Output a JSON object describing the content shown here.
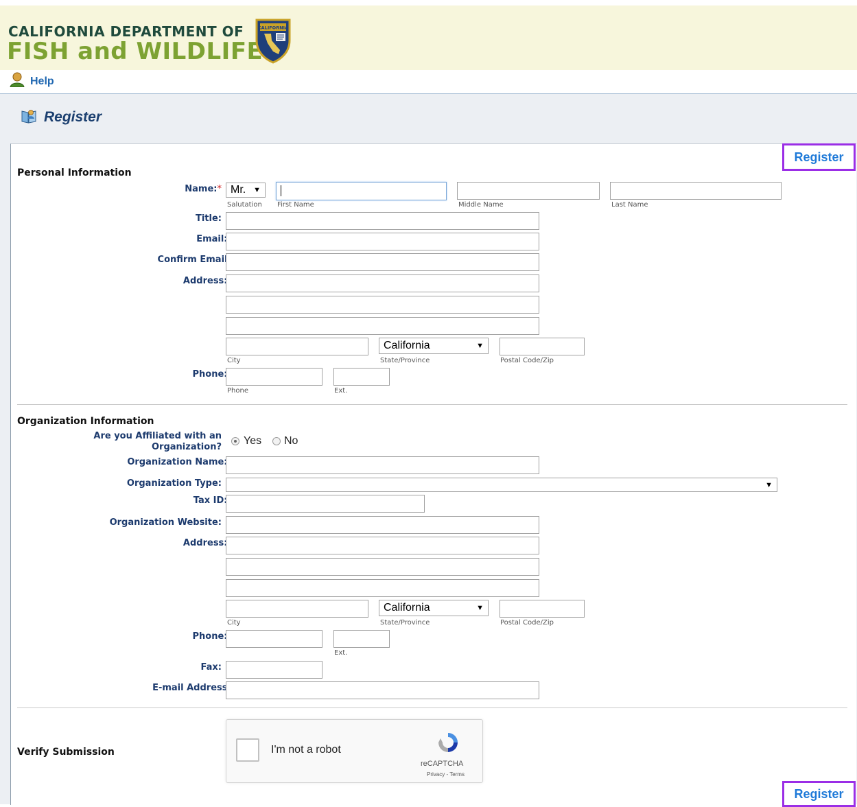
{
  "header": {
    "logo_line1": "CALIFORNIA DEPARTMENT OF",
    "logo_line2": "FISH and WILDLIFE",
    "badge_text": "CALIFORNIA",
    "help_label": "Help"
  },
  "page": {
    "title": "Register",
    "register_button_label": "Register"
  },
  "personal": {
    "section_title": "Personal Information",
    "name_label": "Name:",
    "salutation_value": "Mr.",
    "salutation_caption": "Salutation",
    "first_name_caption": "First Name",
    "middle_name_caption": "Middle Name",
    "last_name_caption": "Last Name",
    "title_label": "Title:",
    "email_label": "Email:",
    "confirm_email_label": "Confirm Email",
    "address_label": "Address:",
    "state_value": "California",
    "city_caption": "City",
    "state_caption": "State/Province",
    "zip_caption": "Postal Code/Zip",
    "phone_label": "Phone:",
    "phone_caption": "Phone",
    "ext_caption": "Ext."
  },
  "organization": {
    "section_title": "Organization Information",
    "affiliated_label_line1": "Are you Affiliated with an",
    "affiliated_label_line2": "Organization?",
    "yes_label": "Yes",
    "no_label": "No",
    "affiliated_selected": "Yes",
    "org_name_label": "Organization Name:",
    "org_type_label": "Organization Type:",
    "tax_id_label": "Tax ID:",
    "website_label": "Organization Website:",
    "address_label": "Address:",
    "state_value": "California",
    "city_caption": "City",
    "state_caption": "State/Province",
    "zip_caption": "Postal Code/Zip",
    "phone_label": "Phone:",
    "ext_caption": "Ext.",
    "fax_label": "Fax:",
    "email_label": "E-mail Address"
  },
  "verify": {
    "section_title": "Verify Submission",
    "captcha_text": "I'm not a robot",
    "captcha_brand": "reCAPTCHA",
    "captcha_links": "Privacy - Terms"
  },
  "required_marker": "*",
  "colors": {
    "label": "#1d3b6e",
    "required": "#d02020",
    "register_border": "#9b2ee6",
    "register_text": "#1f7ad8",
    "banner": "#f7f6dc"
  }
}
